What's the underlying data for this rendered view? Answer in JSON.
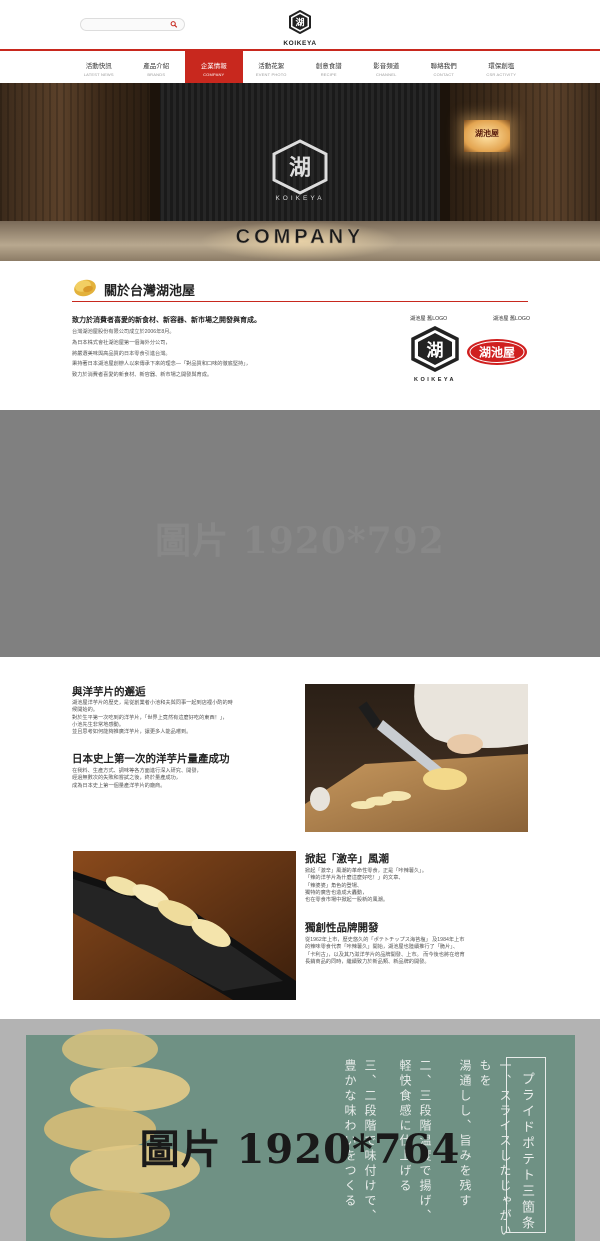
{
  "header": {
    "search_placeholder": "",
    "logo_text": "KOIKEYA"
  },
  "nav": [
    {
      "zh": "活動快訊",
      "en": "LATEST NEWS"
    },
    {
      "zh": "產品介紹",
      "en": "BRANDS"
    },
    {
      "zh": "企業情報",
      "en": "COMPANY"
    },
    {
      "zh": "活動花絮",
      "en": "EVENT PHOTO"
    },
    {
      "zh": "創意食譜",
      "en": "RECIPE"
    },
    {
      "zh": "影音頻道",
      "en": "CHANNEL"
    },
    {
      "zh": "聯絡我們",
      "en": "CONTACT"
    },
    {
      "zh": "環保創塩",
      "en": "CSR ACTIVITY"
    }
  ],
  "nav_active_index": 2,
  "hero": {
    "emblem_text": "KOIKEYA",
    "lamp_text": "湖池屋",
    "title": "COMPANY"
  },
  "about": {
    "title": "關於台灣湖池屋",
    "subtitle": "致力於消費者喜愛的新食材、新容器、新市場之開發與育成。",
    "lines": [
      "台灣湖池屋股份有限公司成立於2006年8月。",
      "為日本株式會社湖池屋第一個海外分公司，",
      "將嚴選美味與高品質的日本零食引進台灣。",
      "秉持著日本湖池屋創辦人以來傳承下來的理念―「對品質和口味的徹底堅持」，",
      "致力於消費者喜愛的新食材、新容器、新市場之開發與育成。"
    ],
    "old_logo_label": "湖池屋 舊LOGO",
    "new_logo_label": "湖池屋 舊LOGO",
    "old_logo_text": "KOIKEYA",
    "new_logo_text": "湖池屋"
  },
  "placeholder1": "圖片 1920*792",
  "story": {
    "encounter_title": "與洋芋片的邂逅",
    "encounter_lines": [
      "湖池屋洋芋片的歷史，是從創業者小池和夫與同事一起到店裡小酌的時",
      "候開始的。",
      "對於生平第一次吃到的洋芋片，「世界上竟然有這麼好吃的東西！」，",
      "小池先生非常地感動。",
      "並且思考如何能夠推廣洋芋片，讓更多人能品嚐到。"
    ],
    "mass_title": "日本史上第一次的洋芋片量產成功",
    "mass_lines": [
      "在我料、生產方式、調味等各方面進行深入研究、開發，",
      "經過無數次的失敗和嘗試之後，終於量產成功，",
      "成為日本史上第一個量產洋芋片的廠商。"
    ],
    "spicy_title": "掀起「激辛」風潮",
    "spicy_lines": [
      "掀起「激辛」風潮的革命性零食，正是「咔辣薯久」。",
      "「辣的洋芋片為什麼這麼好吃！」的文章、",
      "「辣婆婆」角色的登場、",
      "獨特的廣告也造成大轟動，",
      "也在零食市場中掀起一股新的風潮。"
    ],
    "brand_title": "獨創性品牌開發",
    "brand_lines": [
      "從1962年上市，歷史悠久的「ポテトチップス海苔塩」 及1984年上市",
      "的辣味零食代表「咔辣薯久」開始，湖池屋也陸續推行了「脆片」、",
      "「卡利古」，以及其乃滋洋芋片的品牌開發、上市。 而今後也將在培育",
      "長銷商品的同時，繼續致力於新品類、新品牌的開發。"
    ]
  },
  "placeholder2": {
    "label": "圖片 1920*764",
    "box_text": "プライドポテト三箇条",
    "col1": "一、スライスしたじゃがいもを",
    "col1b": "湯通しし、旨みを残す",
    "col2": "二、三段階温度で揚げ、",
    "col2b": "軽快食感に仕上げる",
    "col3": "三、二段階で味付けで、",
    "col3b": "豊かな味わいをつくる"
  }
}
